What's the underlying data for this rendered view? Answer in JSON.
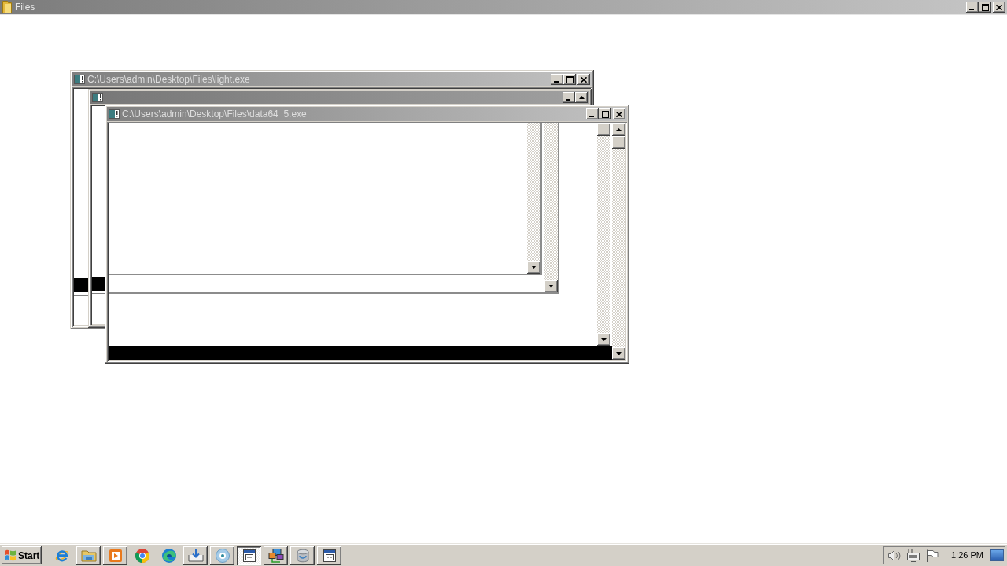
{
  "window": {
    "title": "Files"
  },
  "windows": [
    {
      "kind": "console",
      "title": "C:\\Users\\admin\\Desktop\\Files\\light.exe"
    },
    {
      "kind": "blank"
    },
    {
      "kind": "scrolled",
      "title": "C:\\Users\\admin\\Desktop\\Files\\data64_5.exe"
    }
  ],
  "taskbar": {
    "start_button": "Start",
    "buttons": [
      {
        "running": false,
        "selected": false
      },
      {
        "running": true,
        "selected": false
      },
      {
        "running": true,
        "selected": false
      },
      {
        "running": false,
        "selected": false
      },
      {
        "running": false,
        "selected": false
      },
      {
        "running": true,
        "selected": false
      },
      {
        "running": true,
        "selected": false
      },
      {
        "running": true,
        "selected": true
      },
      {
        "running": true,
        "selected": false
      },
      {
        "running": true,
        "selected": false
      },
      {
        "running": true,
        "selected": false
      }
    ],
    "clock": "1:26 PM"
  }
}
